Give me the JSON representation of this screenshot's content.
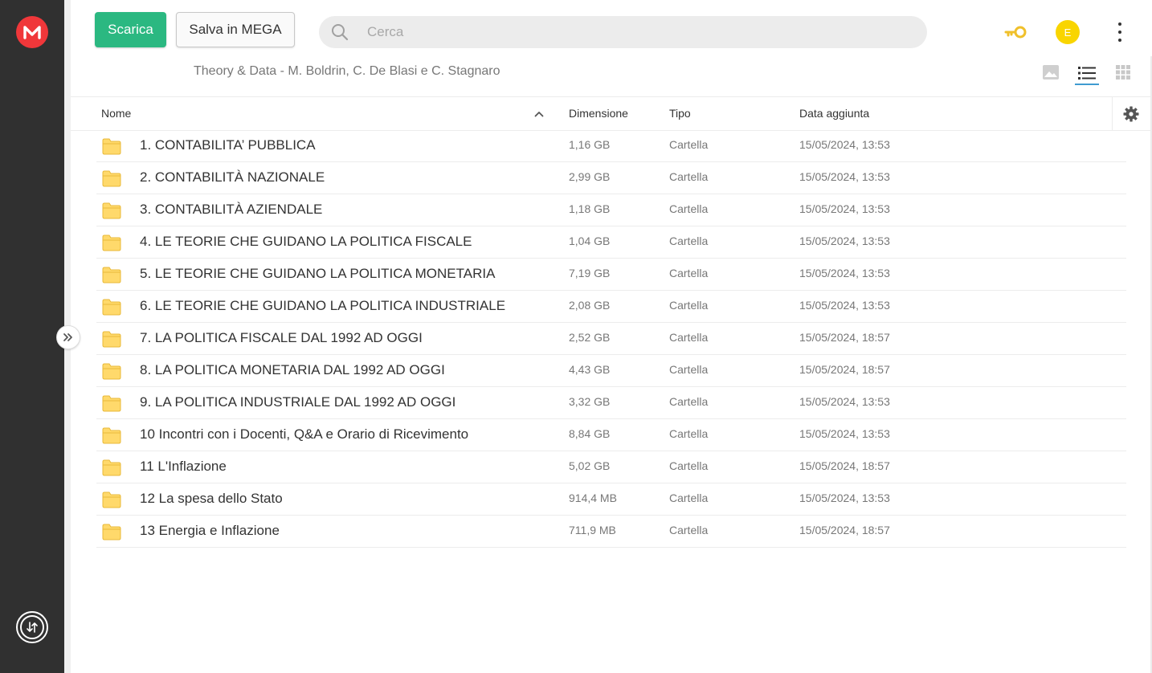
{
  "toolbar": {
    "download_label": "Scarica",
    "save_label": "Salva in MEGA"
  },
  "search": {
    "placeholder": "Cerca"
  },
  "user": {
    "avatar_initial": "E"
  },
  "breadcrumb": "Theory & Data - M. Boldrin, C. De Blasi e C. Stagnaro",
  "table": {
    "headers": {
      "name": "Nome",
      "size": "Dimensione",
      "type": "Tipo",
      "date": "Data aggiunta"
    },
    "rows": [
      {
        "name": "1. CONTABILITA’ PUBBLICA",
        "size": "1,16 GB",
        "type": "Cartella",
        "date": "15/05/2024, 13:53"
      },
      {
        "name": "2. CONTABILITÀ NAZIONALE",
        "size": "2,99 GB",
        "type": "Cartella",
        "date": "15/05/2024, 13:53"
      },
      {
        "name": "3. CONTABILITÀ AZIENDALE",
        "size": "1,18 GB",
        "type": "Cartella",
        "date": "15/05/2024, 13:53"
      },
      {
        "name": "4. LE TEORIE CHE GUIDANO LA POLITICA FISCALE",
        "size": "1,04 GB",
        "type": "Cartella",
        "date": "15/05/2024, 13:53"
      },
      {
        "name": "5. LE TEORIE CHE GUIDANO LA POLITICA MONETARIA",
        "size": "7,19 GB",
        "type": "Cartella",
        "date": "15/05/2024, 13:53"
      },
      {
        "name": "6. LE TEORIE CHE GUIDANO LA POLITICA INDUSTRIALE",
        "size": "2,08 GB",
        "type": "Cartella",
        "date": "15/05/2024, 13:53"
      },
      {
        "name": "7. LA POLITICA FISCALE DAL 1992 AD OGGI",
        "size": "2,52 GB",
        "type": "Cartella",
        "date": "15/05/2024, 18:57"
      },
      {
        "name": "8. LA POLITICA MONETARIA DAL 1992 AD OGGI",
        "size": "4,43 GB",
        "type": "Cartella",
        "date": "15/05/2024, 18:57"
      },
      {
        "name": "9. LA POLITICA INDUSTRIALE DAL 1992 AD OGGI",
        "size": "3,32 GB",
        "type": "Cartella",
        "date": "15/05/2024, 13:53"
      },
      {
        "name": "10 Incontri con i Docenti, Q&A e Orario di Ricevimento",
        "size": "8,84 GB",
        "type": "Cartella",
        "date": "15/05/2024, 13:53"
      },
      {
        "name": "11 L'Inflazione",
        "size": "5,02 GB",
        "type": "Cartella",
        "date": "15/05/2024, 18:57"
      },
      {
        "name": "12 La spesa dello Stato",
        "size": "914,4 MB",
        "type": "Cartella",
        "date": "15/05/2024, 13:53"
      },
      {
        "name": "13 Energia e Inflazione",
        "size": "711,9 MB",
        "type": "Cartella",
        "date": "15/05/2024, 18:57"
      }
    ]
  },
  "icons": {
    "logo": "mega-logo-icon",
    "search": "search-icon",
    "key": "key-icon",
    "menu": "more-vertical-icon",
    "folder": "folder-icon",
    "settings": "gear-icon",
    "transfers": "transfer-icon",
    "expand": "chevron-double-right-icon"
  },
  "colors": {
    "brand_red": "#f0373a",
    "download_green": "#2bb881",
    "avatar_yellow": "#f9d500",
    "key_gold": "#f0c02b",
    "folder_yellow": "#ffd96b",
    "active_blue": "#3f9bd1",
    "sidebar_dark": "#303030"
  }
}
